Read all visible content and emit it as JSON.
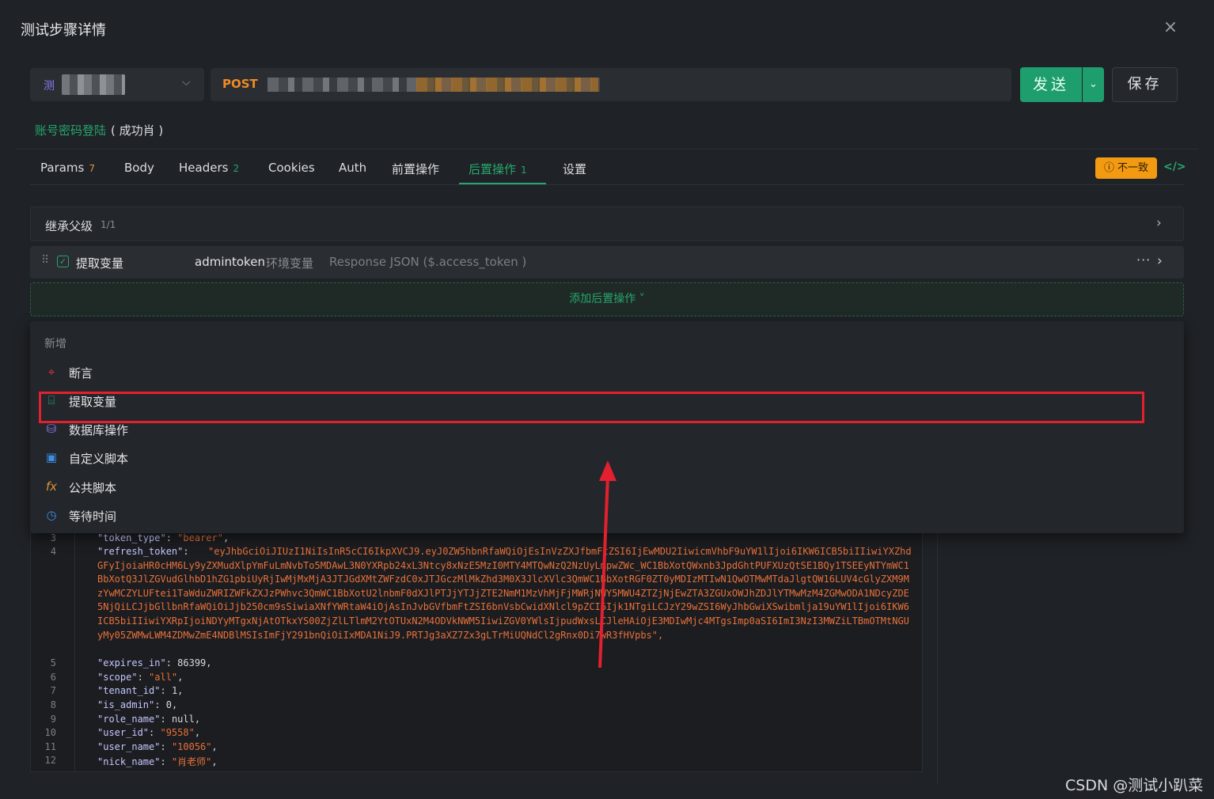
{
  "dialog": {
    "title": "测试步骤详情",
    "close": "×"
  },
  "request": {
    "env_badge": "测",
    "method": "POST",
    "send_label": "发送",
    "send_arrow": "⌄",
    "save_label": "保存",
    "case_link": "账号密码登陆",
    "case_tag": "( 成功肖 )"
  },
  "tabs": [
    {
      "label": "Params",
      "count": "7"
    },
    {
      "label": "Body",
      "count": ""
    },
    {
      "label": "Headers",
      "count": "2"
    },
    {
      "label": "Cookies",
      "count": ""
    },
    {
      "label": "Auth",
      "count": ""
    },
    {
      "label": "前置操作",
      "count": ""
    },
    {
      "label": "后置操作",
      "count": "1"
    },
    {
      "label": "设置",
      "count": ""
    }
  ],
  "warn_badge": "ⓘ 不一致",
  "code_toggle": "</>",
  "inherit": {
    "label": "继承父级",
    "count": "1/1"
  },
  "extract": {
    "name": "提取变量",
    "variable": "admintoken",
    "scope": "环境变量",
    "source": "Response JSON ($.access_token )"
  },
  "add_post_label": "添加后置操作 ˅",
  "dropdown": {
    "header": "新增",
    "items": [
      {
        "label": "断言",
        "icon": "assert-icon",
        "color": "#e0323f"
      },
      {
        "label": "提取变量",
        "icon": "extract-icon",
        "color": "#26a66d"
      },
      {
        "label": "数据库操作",
        "icon": "database-icon",
        "color": "#8a7bf0"
      },
      {
        "label": "自定义脚本",
        "icon": "script-icon",
        "color": "#3d8de0"
      },
      {
        "label": "公共脚本",
        "icon": "fx-icon",
        "color": "#e0903a"
      },
      {
        "label": "等待时间",
        "icon": "clock-icon",
        "color": "#3d8de0"
      }
    ]
  },
  "code": {
    "line3": {
      "n": "3",
      "key": "\"token_type\"",
      "val": "\"bearer\""
    },
    "line4": {
      "n": "4",
      "key": "\"refresh_token\""
    },
    "refresh_token": "\"eyJhbGciOiJIUzI1NiIsInR5cCI6IkpXVCJ9.eyJ0ZW5hbnRfaWQiOjEsInVzZXJfbmFtZSI6IjEwMDU2IiwicmVhbF9uYW1lIjoi6IKW6ICB5biIIiwiYXZhdGFyIjoiaHR0cHM6Ly9yZXMudXlpYmFuLmNvbTo5MDAwL3N0YXRpb24xL3Ntcy8xNzE5MzI0MTY4MTQwNzQ2NzUyLmpwZWc_WC1BbXotQWxnb3JpdGhtPUFXUzQtSE1BQy1TSEEyNTYmWC1BbXotQ3JlZGVudGlhbD1hZG1pbiUyRjIwMjMxMjA3JTJGdXMtZWFzdC0xJTJGczMlMkZhd3M0X3JlcXVlc3QmWC1BbXotRGF0ZT0yMDIzMTIwN1QwOTMwMTdaJlgtQW16LUV4cGlyZXM9MzYwMCZYLUFtei1TaWduZWRIZWFkZXJzPWhvc3QmWC1BbXotU2lnbmF0dXJlPTJjYTJjZTE2NmM1MzVhMjFjMWRjNWY5MWU4ZTZjNjEwZTA3ZGUxOWJhZDJlYTMwMzM4ZGMwODA1NDcyZDE5NjQiLCJjbGllbnRfaWQiOiJjb250cm9sSiwiaXNfYWRtaW4iOjAsInJvbGVfbmFtZSI6bnVsbCwidXNlcl9pZCI6Ijk1NTgiLCJzY29wZSI6WyJhbGwiXSwibmlja19uYW1lIjoi6IKW6ICB5biIIiwiYXRpIjoiNDYyMTgxNjAtOTkxYS00ZjZlLTlmM2YtOTUxN2M4ODVkNWM5IiwiZGV0YWlsIjpudWxsLCJleHAiOjE3MDIwMjc4MTgsImp0aSI6ImI3NzI3MWZiLTBmOTMtNGUyMy05ZWMwLWM4ZDMwZmE4NDBlMSIsImFjY291bnQiOiIxMDA1NiJ9.PRTJg3aXZ7Zx3gLTrMiUQNdCl2gRnx0Di7wR3fHVpbs\",",
    "lines": [
      {
        "n": "5",
        "key": "\"expires_in\"",
        "val": "86399",
        "type": "num"
      },
      {
        "n": "6",
        "key": "\"scope\"",
        "val": "\"all\"",
        "type": "str"
      },
      {
        "n": "7",
        "key": "\"tenant_id\"",
        "val": "1",
        "type": "num"
      },
      {
        "n": "8",
        "key": "\"is_admin\"",
        "val": "0",
        "type": "num"
      },
      {
        "n": "9",
        "key": "\"role_name\"",
        "val": "null",
        "type": "num"
      },
      {
        "n": "10",
        "key": "\"user_id\"",
        "val": "\"9558\"",
        "type": "str"
      },
      {
        "n": "11",
        "key": "\"user_name\"",
        "val": "\"10056\"",
        "type": "str"
      },
      {
        "n": "12",
        "key": "\"nick_name\"",
        "val": "\"肖老师\"",
        "type": "str"
      }
    ]
  },
  "watermark": "CSDN @测试小趴菜"
}
